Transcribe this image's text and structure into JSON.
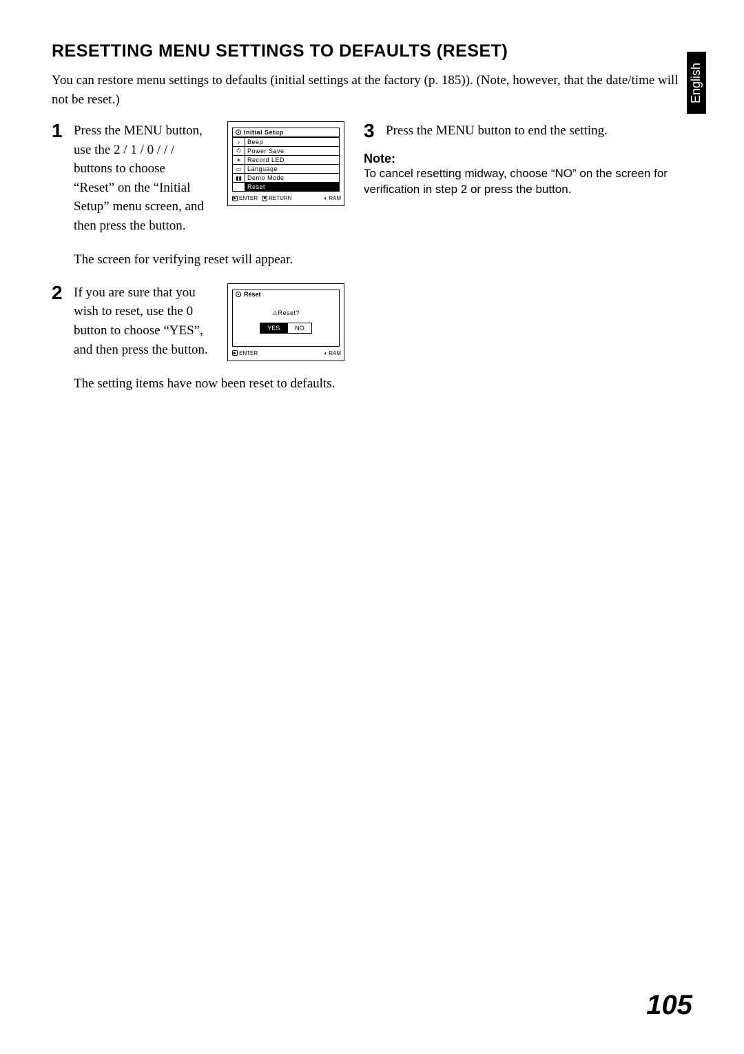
{
  "language_tab": "English",
  "heading": "RESETTING MENU SETTINGS TO DEFAULTS (RESET)",
  "intro": "You can restore menu settings to defaults (initial settings at the factory (p. 185)). (Note, however, that the date/time will not be reset.)",
  "steps": {
    "s1": {
      "num": "1",
      "text": "Press the MENU button, use the  2   /  1   / 0   /  /    /   buttons to choose “Reset” on the “Initial Setup” menu screen, and then press the          button.",
      "followup": "The screen for verifying reset will appear."
    },
    "s2": {
      "num": "2",
      "text": "If you are sure that you wish to reset, use the  0    button to choose “YES”, and then press the           button.",
      "followup": "The setting items have now been reset to defaults."
    },
    "s3": {
      "num": "3",
      "text": "Press the MENU button to end the setting."
    }
  },
  "note": {
    "label": "Note:",
    "text": "To cancel resetting midway, choose “NO” on the screen for verification in step 2 or press the       button."
  },
  "screen1": {
    "title": "Initial Setup",
    "items": [
      "Beep",
      "Power Save",
      "Record LED",
      "Language",
      "Demo Mode",
      "Reset"
    ],
    "selected": "Reset",
    "footer_enter": "ENTER",
    "footer_return": "RETURN",
    "footer_ram": "RAM"
  },
  "screen2": {
    "title": "Reset",
    "prompt": "Reset?",
    "yes": "YES",
    "no": "NO",
    "selected": "YES",
    "footer_enter": "ENTER",
    "footer_ram": "RAM"
  },
  "page_number": "105"
}
